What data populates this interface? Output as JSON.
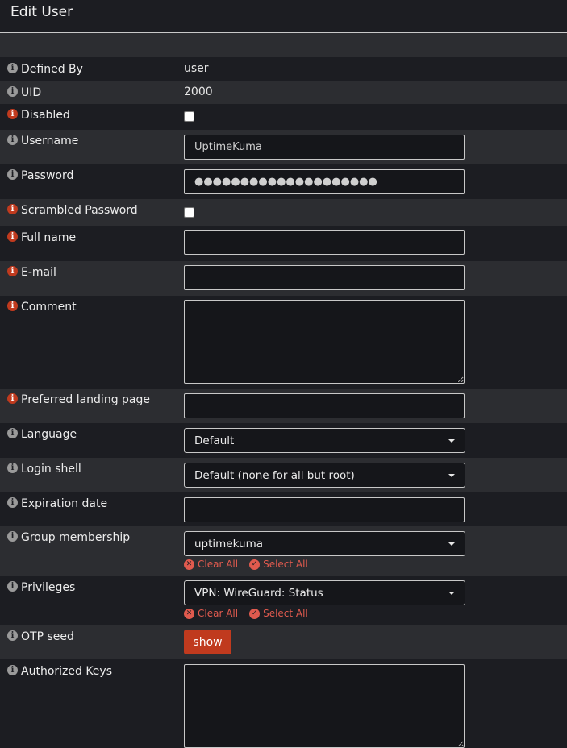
{
  "title": "Edit User",
  "fields": {
    "defined_by": {
      "label": "Defined By",
      "value": "user"
    },
    "uid": {
      "label": "UID",
      "value": "2000"
    },
    "disabled": {
      "label": "Disabled"
    },
    "username": {
      "label": "Username",
      "value": "UptimeKuma"
    },
    "password": {
      "label": "Password",
      "value": "●●●●●●●●●●●●●●●●●●●●"
    },
    "scrambled_password": {
      "label": "Scrambled Password"
    },
    "full_name": {
      "label": "Full name",
      "value": ""
    },
    "email": {
      "label": "E-mail",
      "value": ""
    },
    "comment": {
      "label": "Comment",
      "value": ""
    },
    "landing_page": {
      "label": "Preferred landing page",
      "value": ""
    },
    "language": {
      "label": "Language",
      "value": "Default"
    },
    "login_shell": {
      "label": "Login shell",
      "value": "Default (none for all but root)"
    },
    "expiration_date": {
      "label": "Expiration date",
      "value": ""
    },
    "group_membership": {
      "label": "Group membership",
      "value": "uptimekuma"
    },
    "privileges": {
      "label": "Privileges",
      "value": "VPN: WireGuard: Status"
    },
    "otp_seed": {
      "label": "OTP seed",
      "button": "show"
    },
    "authorized_keys": {
      "label": "Authorized Keys",
      "value": ""
    }
  },
  "actions": {
    "clear_all": "Clear All",
    "select_all": "Select All"
  },
  "icons": {
    "info": "i",
    "clear": "✕",
    "select": "✓"
  },
  "colors": {
    "accent": "#c03a1e",
    "action_text": "#e05a4e",
    "info_grey": "#9a9a9a"
  }
}
